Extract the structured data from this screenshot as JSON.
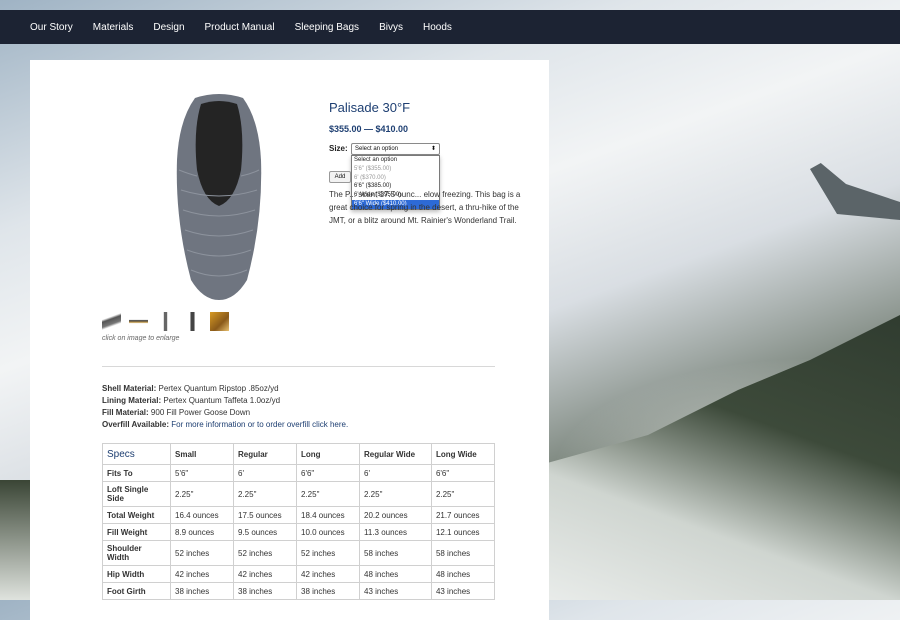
{
  "nav": {
    "items": [
      "Our Story",
      "Materials",
      "Design",
      "Product Manual",
      "Sleeping Bags",
      "Bivys",
      "Hoods"
    ]
  },
  "product": {
    "title": "Palisade 30°F",
    "price": "$355.00 — $410.00",
    "size_label": "Size:",
    "select_value": "Select an option",
    "options": [
      "Select an option",
      "5'6\" ($355.00)",
      "6' ($370.00)",
      "6'6\" ($385.00)",
      "6' Wide ($395.00)",
      "6'6\" Wide ($410.00)"
    ],
    "add_button": "Add",
    "description": "The P... scant 17.5 ounc... elow freezing. This bag is a great choice for spring in the desert, a thru-hike of the JMT, or a blitz around Mt. Rainier's Wonderland Trail.",
    "enlarge_note": "click on image to enlarge"
  },
  "materials": {
    "shell_label": "Shell Material:",
    "shell_value": "Pertex Quantum Ripstop .85oz/yd",
    "lining_label": "Lining Material:",
    "lining_value": "Pertex Quantum Taffeta 1.0oz/yd",
    "fill_label": "Fill Material:",
    "fill_value": "900 Fill Power Goose Down",
    "overfill_label": "Overfill Available:",
    "overfill_link": "For more information or to order overfill click here."
  },
  "specs": {
    "headers": [
      "Specs",
      "Small",
      "Regular",
      "Long",
      "Regular Wide",
      "Long Wide"
    ],
    "rows": [
      [
        "Fits To",
        "5'6\"",
        "6'",
        "6'6\"",
        "6'",
        "6'6\""
      ],
      [
        "Loft Single Side",
        "2.25\"",
        "2.25\"",
        "2.25\"",
        "2.25\"",
        "2.25\""
      ],
      [
        "Total Weight",
        "16.4 ounces",
        "17.5 ounces",
        "18.4 ounces",
        "20.2 ounces",
        "21.7 ounces"
      ],
      [
        "Fill Weight",
        "8.9 ounces",
        "9.5 ounces",
        "10.0 ounces",
        "11.3 ounces",
        "12.1 ounces"
      ],
      [
        "Shoulder Width",
        "52 inches",
        "52 inches",
        "52 inches",
        "58 inches",
        "58 inches"
      ],
      [
        "Hip Width",
        "42 inches",
        "42 inches",
        "42 inches",
        "48 inches",
        "48 inches"
      ],
      [
        "Foot Girth",
        "38 inches",
        "38 inches",
        "38 inches",
        "43 inches",
        "43 inches"
      ]
    ]
  },
  "colors": {
    "nav_bg": "#1c2333",
    "accent": "#1e3f72",
    "selected_option": "#2d6ad6"
  }
}
